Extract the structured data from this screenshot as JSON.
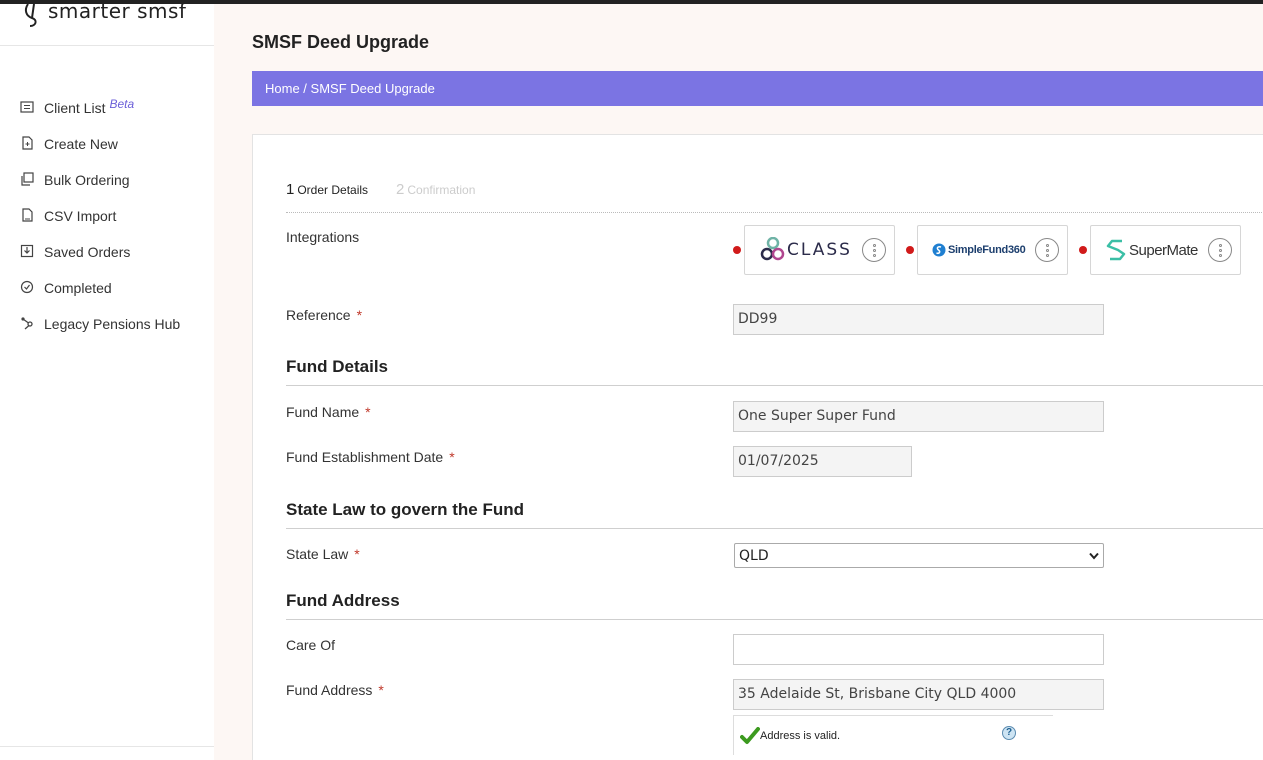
{
  "brand": {
    "name": "smarter smsf"
  },
  "sidebar": {
    "items": [
      {
        "label": "Client List",
        "badge": "Beta",
        "icon": "list-icon"
      },
      {
        "label": "Create New",
        "icon": "new-file-icon"
      },
      {
        "label": "Bulk Ordering",
        "icon": "copy-icon"
      },
      {
        "label": "CSV Import",
        "icon": "file-icon"
      },
      {
        "label": "Saved Orders",
        "icon": "save-icon"
      },
      {
        "label": "Completed",
        "icon": "check-circle-icon"
      },
      {
        "label": "Legacy Pensions Hub",
        "icon": "hub-icon"
      }
    ]
  },
  "page": {
    "title": "SMSF Deed Upgrade",
    "breadcrumb": {
      "home": "Home",
      "separator": " / ",
      "current": "SMSF Deed Upgrade"
    }
  },
  "steps": [
    {
      "num": "1",
      "label": "Order Details",
      "active": true
    },
    {
      "num": "2",
      "label": "Confirmation",
      "active": false
    }
  ],
  "form": {
    "integrations_label": "Integrations",
    "integrations": [
      {
        "name": "CLASS"
      },
      {
        "name": "SimpleFund360"
      },
      {
        "name": "SuperMate"
      }
    ],
    "reference": {
      "label": "Reference",
      "value": "DD99"
    },
    "fund_details_title": "Fund Details",
    "fund_name": {
      "label": "Fund Name",
      "value": "One Super Super Fund"
    },
    "establishment_date": {
      "label": "Fund Establishment Date",
      "value": "01/07/2025"
    },
    "state_law_title": "State Law to govern the Fund",
    "state_law": {
      "label": "State Law",
      "value": "QLD"
    },
    "fund_address_title": "Fund Address",
    "care_of": {
      "label": "Care Of",
      "value": ""
    },
    "fund_address": {
      "label": "Fund Address",
      "value": "35 Adelaide St, Brisbane City QLD 4000"
    },
    "address_status": "Address is valid.",
    "required_marker": "*"
  },
  "colors": {
    "accent": "#7b74e3",
    "required": "#c0392b",
    "integration_dot": "#d11a1a"
  }
}
